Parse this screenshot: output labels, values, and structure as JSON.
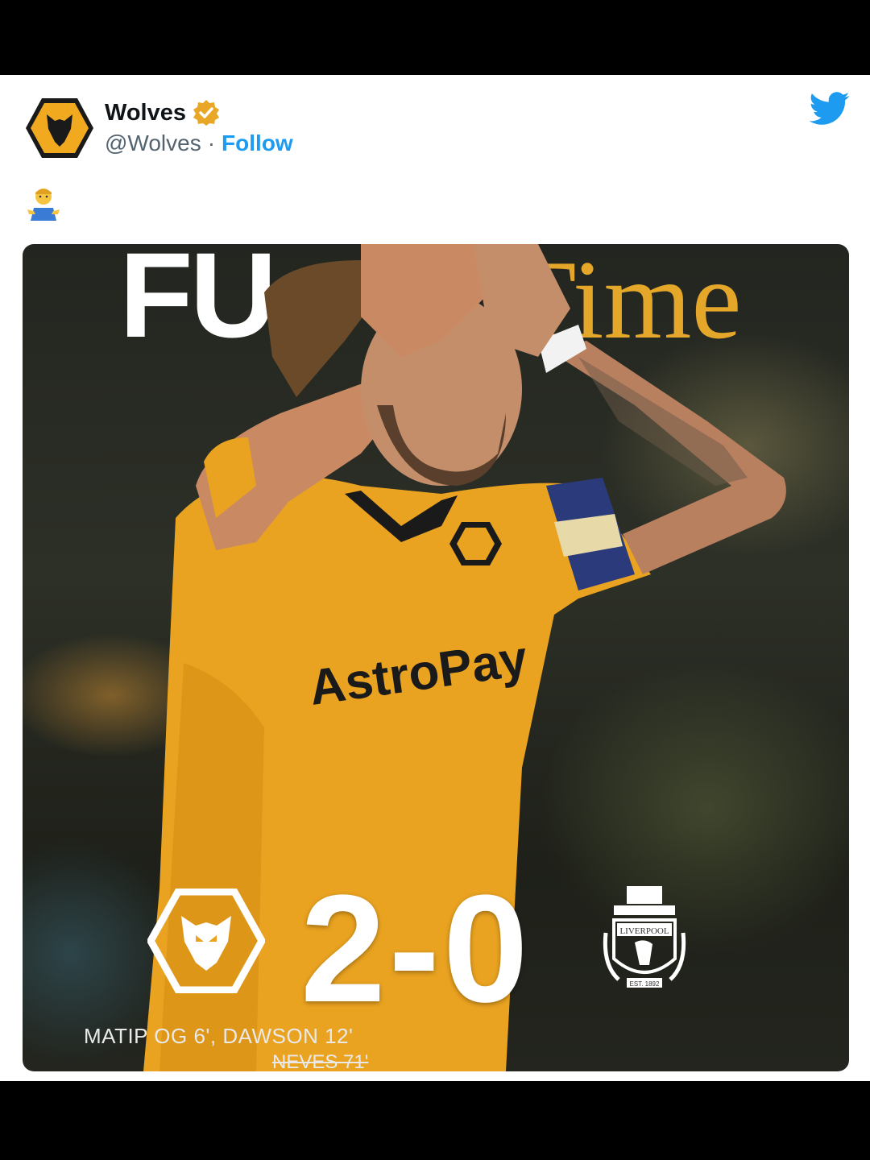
{
  "tweet": {
    "account_name": "Wolves",
    "handle": "@Wolves",
    "separator": "·",
    "follow_label": "Follow",
    "body_emoji": "🤷‍♂️"
  },
  "graphic": {
    "title_white": "FU",
    "title_gold": "Time",
    "score": "2-0",
    "scorers_line1": "MATIP OG 6', DAWSON 12'",
    "scorers_line2": "NEVES 71'",
    "shirt_sponsor": "AstroPay",
    "lfc_crest_text": "LIVERPOOL",
    "lfc_crest_subtext": "EST. 1892"
  },
  "colors": {
    "accent_gold": "#e4a72a",
    "twitter_blue": "#1d9bf0",
    "verified_gold": "#e8a726"
  }
}
